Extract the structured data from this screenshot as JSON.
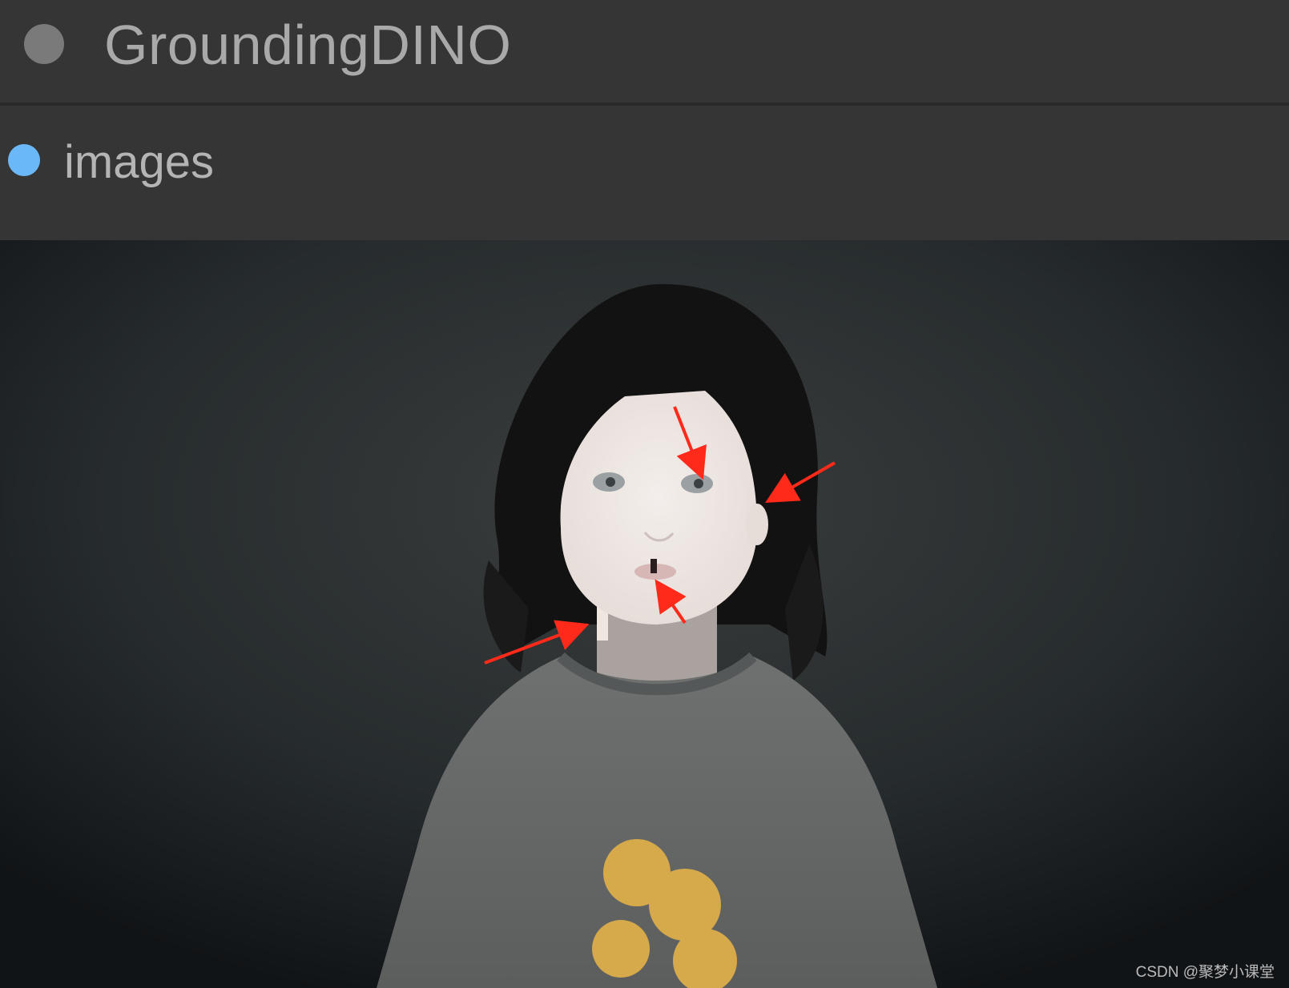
{
  "node": {
    "title": "GroundingDINO"
  },
  "output": {
    "label": "images",
    "slot_color": "#6ab8f7"
  },
  "preview": {
    "watermark": "CSDN @聚梦小课堂",
    "annotation_arrow_color": "#ff2a1a"
  }
}
